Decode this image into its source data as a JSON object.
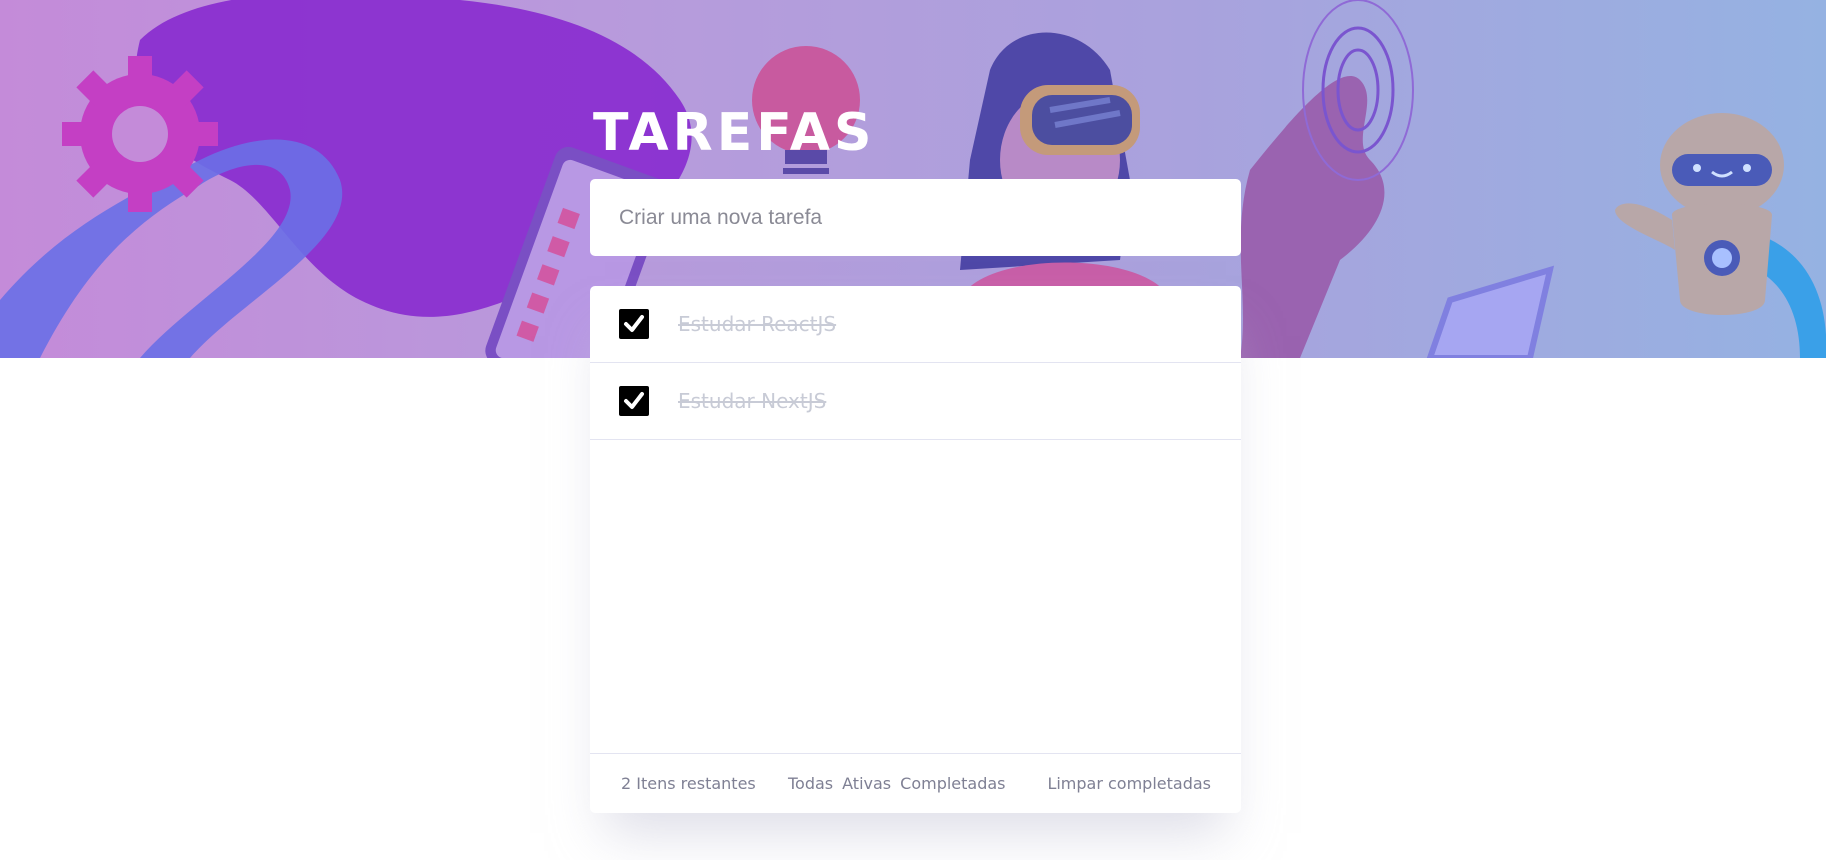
{
  "header": {
    "title": "TAREFAS"
  },
  "new_task": {
    "placeholder": "Criar uma nova tarefa",
    "value": ""
  },
  "todos": [
    {
      "text": "Estudar ReactJS",
      "completed": true
    },
    {
      "text": "Estudar NextJS",
      "completed": true
    }
  ],
  "footer": {
    "items_left": "2 Itens restantes",
    "filters": [
      "Todas",
      "Ativas",
      "Completadas"
    ],
    "clear_label": "Limpar completadas"
  },
  "colors": {
    "accent": "#7b2fd3",
    "checkbox": "#000000",
    "completed_text": "#c8cbd6",
    "footer_text": "#7f8094"
  },
  "icons": [
    "checkmark-icon",
    "gear-illustration",
    "lightbulb-illustration",
    "robot-illustration"
  ]
}
